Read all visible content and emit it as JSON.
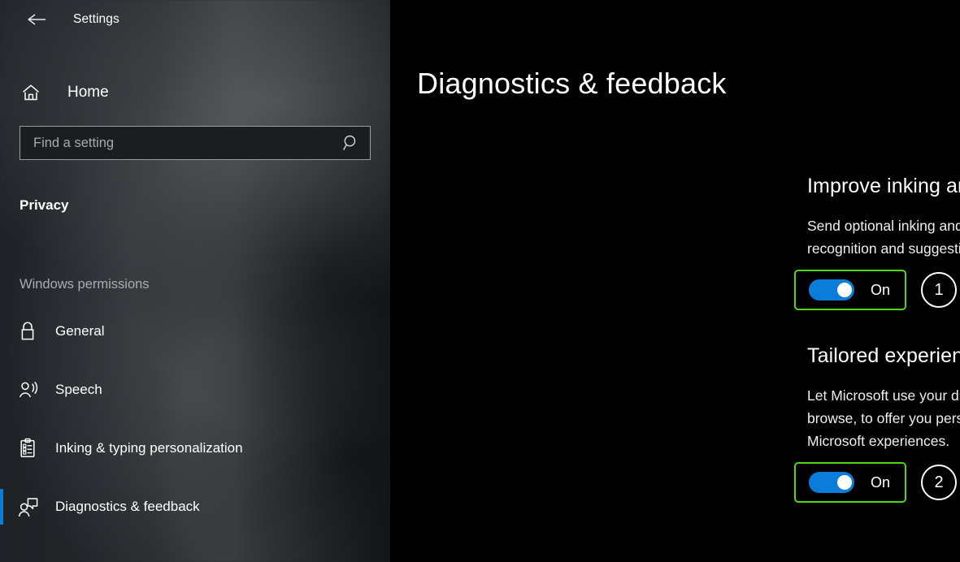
{
  "window": {
    "title": "Settings",
    "back_icon": "back-arrow-icon"
  },
  "sidebar": {
    "home": {
      "label": "Home",
      "icon": "home-icon"
    },
    "search": {
      "value": "",
      "placeholder": "Find a setting",
      "icon": "search-icon"
    },
    "page_label": "Privacy",
    "group_label": "Windows permissions",
    "items": [
      {
        "label": "General",
        "icon": "lock-icon",
        "selected": false
      },
      {
        "label": "Speech",
        "icon": "speech-person-icon",
        "selected": false
      },
      {
        "label": "Inking & typing personalization",
        "icon": "clipboard-checklist-icon",
        "selected": false
      },
      {
        "label": "Diagnostics & feedback",
        "icon": "person-feedback-icon",
        "selected": true
      }
    ]
  },
  "main": {
    "title": "Diagnostics & feedback",
    "watermark_icon": "cartoon-mascot-watermark",
    "sections": [
      {
        "title": "Improve inking and typing",
        "description": "Send optional inking and typing diagnostic data to Microsoft to improve the language recognition and suggestion capabilities of apps and services running on Windows.",
        "toggle_state": "On",
        "marker": "1"
      },
      {
        "title": "Tailored experiences",
        "description": "Let Microsoft use your diagnostic data, excluding information about websites you browse, to offer you personalized tips, ads, and recommendations to enhance your Microsoft experiences.",
        "toggle_state": "On",
        "marker": "2"
      }
    ]
  },
  "colors": {
    "accent_blue": "#0a7ddb",
    "annotation_green": "#52d419",
    "background": "#000000",
    "sidebar_base": "#222528"
  }
}
